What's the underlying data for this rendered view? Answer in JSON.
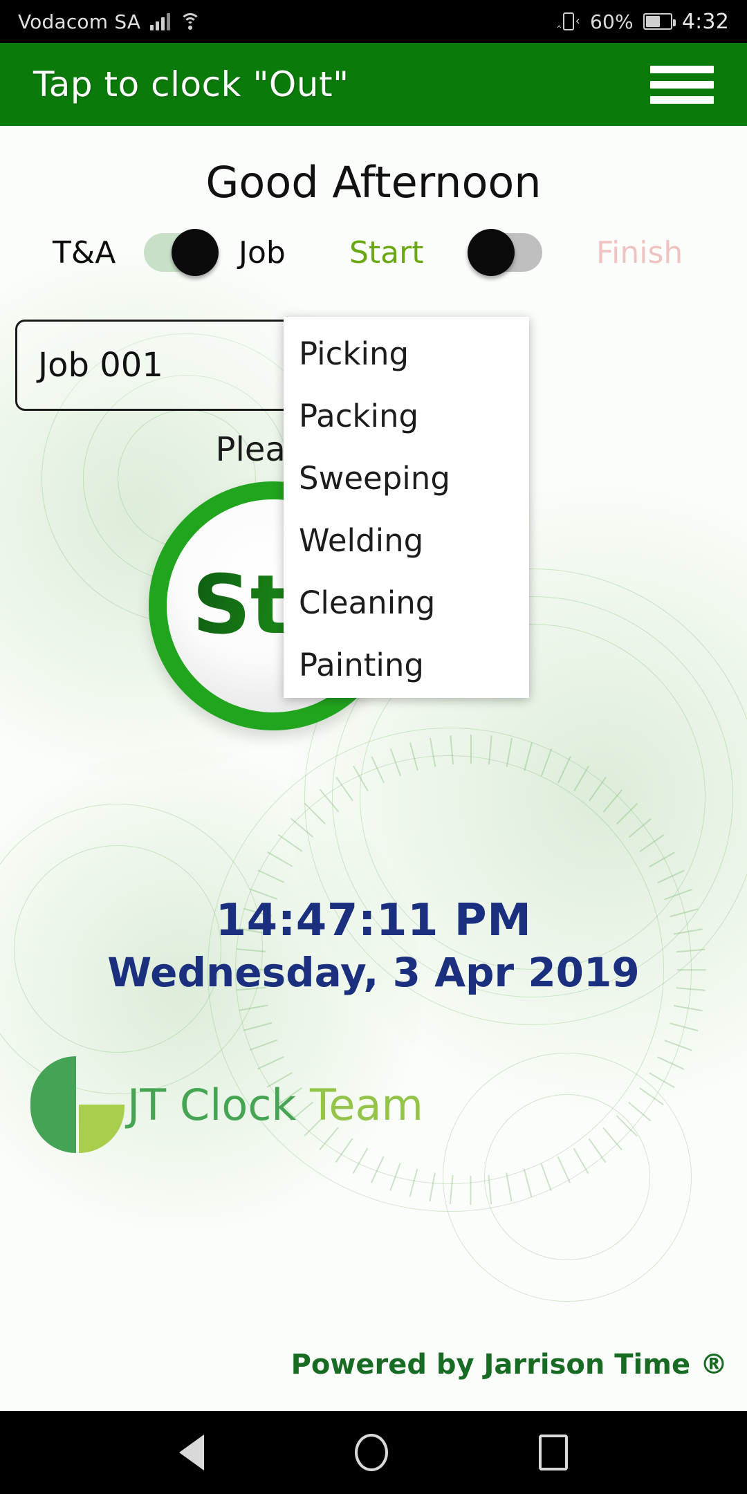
{
  "statusbar": {
    "carrier": "Vodacom SA",
    "signal_icon": "signal-bars-icon",
    "wifi_icon": "wifi-icon",
    "vibrate_icon": "vibrate-icon",
    "battery_percent": "60%",
    "battery_level": 60,
    "battery_icon": "battery-icon",
    "time": "4:32"
  },
  "appbar": {
    "title": "Tap to clock \"Out\"",
    "menu_icon": "hamburger-menu-icon",
    "background_color": "#0a7a0a"
  },
  "main": {
    "greeting": "Good Afternoon",
    "toggles": [
      {
        "left_label": "T&A",
        "right_label": "Job",
        "state": "right",
        "track_color": "#c9e0c8",
        "thumb_color": "#0b0b0b"
      },
      {
        "left_label": "Start",
        "right_label": "Finish",
        "state": "left",
        "track_color": "#bfbfbf",
        "thumb_color": "#0b0b0b"
      }
    ],
    "labels": {
      "ta": "T&A",
      "job": "Job",
      "start": "Start",
      "finish": "Finish",
      "start_color": "#6aa80f",
      "finish_color": "#f0c3c3"
    },
    "job_select": {
      "value": "Job 001",
      "caret_icon": "chevron-down-icon"
    },
    "dropdown": {
      "open": true,
      "options": [
        "Picking",
        "Packing",
        "Sweeping",
        "Welding",
        "Cleaning",
        "Painting"
      ]
    },
    "instruction": "Please present you",
    "start_button": {
      "label": "Start",
      "ring_color": "#22a51e"
    },
    "clock": {
      "time": "14:47:11 PM",
      "date": "Wednesday, 3 Apr 2019",
      "color": "#1b2f7f"
    }
  },
  "footer": {
    "logo_icon": "jt-clock-team-logo",
    "brand_primary": "JT Clock ",
    "brand_secondary": "Team",
    "brand_primary_color": "#46a552",
    "brand_secondary_color": "#95c44b",
    "powered_by": "Powered by Jarrison Time ®"
  },
  "navbar": {
    "back_icon": "back-triangle-icon",
    "home_icon": "home-circle-icon",
    "recents_icon": "recents-square-icon"
  }
}
